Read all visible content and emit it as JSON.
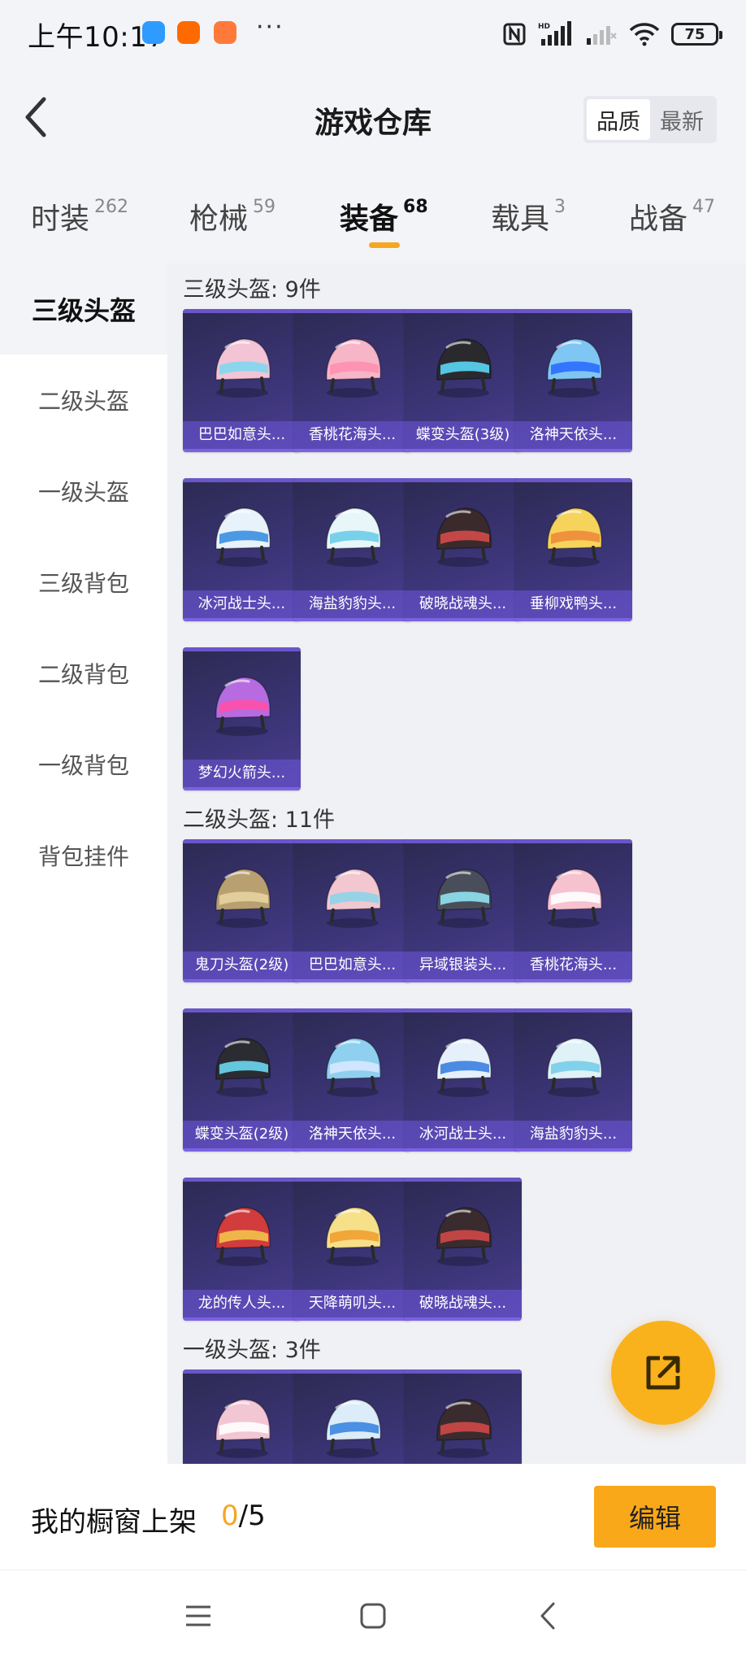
{
  "status_bar": {
    "time": "上午10:17",
    "more": "···",
    "battery": "75",
    "app_icons": [
      {
        "name": "message-app-icon",
        "color": "#2f9bff"
      },
      {
        "name": "mi-app-icon",
        "color": "#ff6a00"
      },
      {
        "name": "mall-app-icon",
        "color": "#ff7a3a"
      }
    ]
  },
  "header": {
    "title": "游戏仓库",
    "sort_quality": "品质",
    "sort_newest": "最新"
  },
  "tabs": [
    {
      "label": "时装",
      "count": "262"
    },
    {
      "label": "枪械",
      "count": "59"
    },
    {
      "label": "装备",
      "count": "68"
    },
    {
      "label": "载具",
      "count": "3"
    },
    {
      "label": "战备",
      "count": "47"
    }
  ],
  "sidebar": [
    {
      "label": "三级头盔"
    },
    {
      "label": "二级头盔"
    },
    {
      "label": "一级头盔"
    },
    {
      "label": "三级背包"
    },
    {
      "label": "二级背包"
    },
    {
      "label": "一级背包"
    },
    {
      "label": "背包挂件"
    }
  ],
  "sections": [
    {
      "title": "三级头盔: 9件",
      "items": [
        {
          "name": "巴巴如意头...",
          "color": "#f2c4d6",
          "accent": "#7fd8f0"
        },
        {
          "name": "香桃花海头...",
          "color": "#f6b6c8",
          "accent": "#ff8fb0"
        },
        {
          "name": "蝶变头盔(3级)",
          "color": "#2a2a2e",
          "accent": "#5ad6f5"
        },
        {
          "name": "洛神天依头...",
          "color": "#7fc6f5",
          "accent": "#2c6cff"
        },
        {
          "name": "冰河战士头...",
          "color": "#e8f2fb",
          "accent": "#3a8fe0"
        },
        {
          "name": "海盐豹豹头...",
          "color": "#e8f6fa",
          "accent": "#6ccde8"
        },
        {
          "name": "破晓战魂头...",
          "color": "#3a2a2c",
          "accent": "#d44a4a"
        },
        {
          "name": "垂柳戏鸭头...",
          "color": "#f6d35a",
          "accent": "#f08a3a"
        },
        {
          "name": "梦幻火箭头...",
          "color": "#b66ce0",
          "accent": "#ff4fa8"
        }
      ]
    },
    {
      "title": "二级头盔: 11件",
      "items": [
        {
          "name": "鬼刀头盔(2级)",
          "color": "#b8a070",
          "accent": "#e6d3a0"
        },
        {
          "name": "巴巴如意头...",
          "color": "#f2c7d0",
          "accent": "#8ed3e8"
        },
        {
          "name": "异域银装头...",
          "color": "#4a4e5a",
          "accent": "#8fe3f0"
        },
        {
          "name": "香桃花海头...",
          "color": "#f6c2d0",
          "accent": "#ffffff"
        },
        {
          "name": "蝶变头盔(2级)",
          "color": "#2b2c32",
          "accent": "#6ad8f0"
        },
        {
          "name": "洛神天依头...",
          "color": "#8fd0f0",
          "accent": "#d7e8ff"
        },
        {
          "name": "冰河战士头...",
          "color": "#e6f0fb",
          "accent": "#3b7fe0"
        },
        {
          "name": "海盐豹豹头...",
          "color": "#dff2f8",
          "accent": "#78cde8"
        },
        {
          "name": "龙的传人头...",
          "color": "#d23c3c",
          "accent": "#f2c24a"
        },
        {
          "name": "天降萌叽头...",
          "color": "#f7e08a",
          "accent": "#f0a030"
        },
        {
          "name": "破晓战魂头...",
          "color": "#3a2b2e",
          "accent": "#d04848"
        }
      ]
    },
    {
      "title": "一级头盔: 3件",
      "items": [
        {
          "name": "",
          "color": "#f3c6d4",
          "accent": "#ffffff"
        },
        {
          "name": "",
          "color": "#dcecf8",
          "accent": "#3a86e0"
        },
        {
          "name": "",
          "color": "#3a2c2e",
          "accent": "#d04848"
        }
      ]
    }
  ],
  "shelf": {
    "label": "我的橱窗上架",
    "current": "0",
    "total": "/5",
    "edit": "编辑"
  }
}
